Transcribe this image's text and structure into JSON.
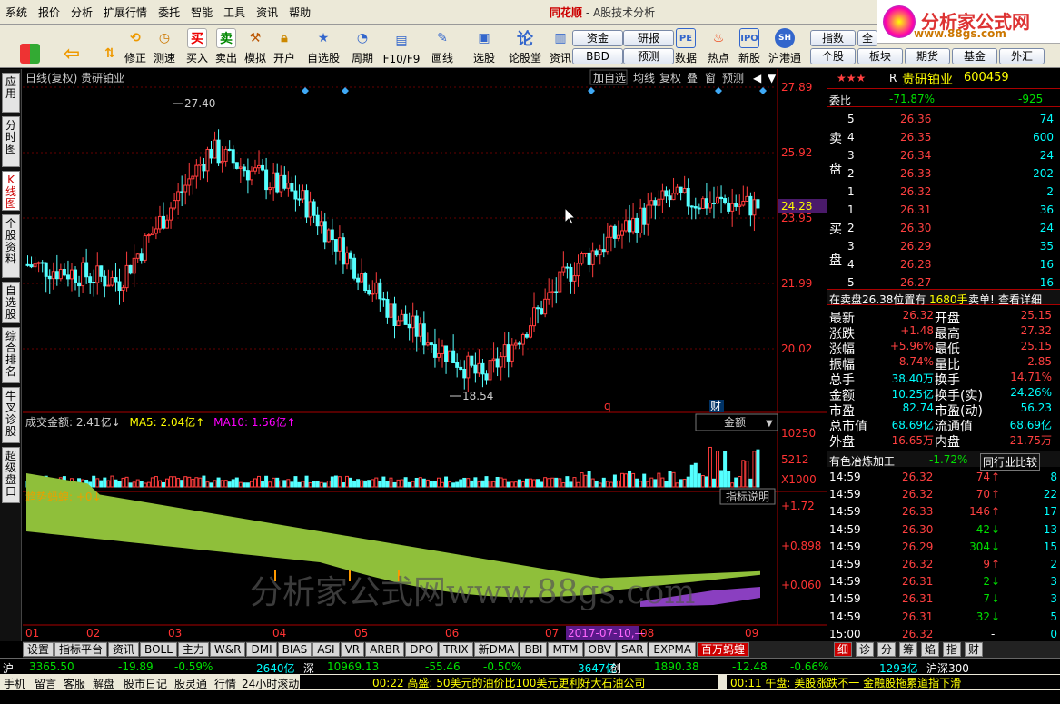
{
  "menu": [
    "系统",
    "报价",
    "分析",
    "扩展行情",
    "委托",
    "智能",
    "工具",
    "资讯",
    "帮助"
  ],
  "app": {
    "brand": "同花顺",
    "sub": " - A股技术分析"
  },
  "toolbar": {
    "buttons": [
      "修正",
      "测速",
      "买入",
      "卖出",
      "模拟",
      "开户",
      "自选股",
      "周期",
      "F10/F9",
      "画线",
      "选股",
      "论股堂",
      "资讯",
      "数据",
      "热点",
      "新股",
      "沪港通"
    ],
    "small": [
      "资金",
      "研报",
      "BBD",
      "预测",
      "指数",
      "全",
      "个股",
      "板块",
      "期货",
      "基金",
      "外汇"
    ]
  },
  "logo": {
    "title": "分析家公式网",
    "url": "www.88gs.com"
  },
  "sidetabs": [
    "应用",
    "分时图",
    "K线图",
    "个股资料",
    "自选股",
    "综合排名",
    "牛叉诊股",
    "超级盘口"
  ],
  "chart": {
    "header": "日线(复权) 贵研铂业",
    "ctrls": [
      "加自选",
      "均线",
      "复权",
      "叠",
      "窗",
      "预测"
    ],
    "high_label": "27.40",
    "low_label": "18.54",
    "y_ticks": [
      "27.89",
      "25.92",
      "23.95",
      "21.99",
      "20.02"
    ],
    "cur_price": "24.28",
    "vol_header": {
      "a": "成交金额: 2.41亿↓",
      "b": "MA5: 2.04亿↑",
      "c": "MA10: 1.56亿↑"
    },
    "vol_select": "金额",
    "vol_ticks": [
      "10250",
      "5212",
      "X1000"
    ],
    "ind_header": "趋势蚂蝗: +0↓",
    "ind_btn": "指标说明",
    "ind_ticks": [
      "+1.72",
      "+0.898",
      "+0.060"
    ],
    "months": [
      "01",
      "02",
      "03",
      "04",
      "05",
      "06",
      "07",
      "08",
      "09"
    ],
    "date_tag": "2017-07-10,—",
    "markers": [
      "q",
      "财"
    ],
    "watermark": "分析家公式网www.88gs.com"
  },
  "chart_data": {
    "type": "line",
    "title": "",
    "x": [
      "01",
      "02",
      "03",
      "04",
      "05",
      "06",
      "07",
      "08",
      "09"
    ],
    "values": [
      22.5,
      22.0,
      26.0,
      24.5,
      21.0,
      19.0,
      22.5,
      24.5,
      24.28
    ],
    "ylim": [
      18.5,
      27.9
    ]
  },
  "rpanel": {
    "stars": "★★★",
    "r": "R",
    "name": "贵研铂业",
    "code": "600459",
    "weibi_label": "委比",
    "weibi": "-71.87%",
    "weicha": "-925",
    "sell": [
      [
        "5",
        "26.36",
        "74"
      ],
      [
        "4",
        "26.35",
        "600"
      ],
      [
        "3",
        "26.34",
        "24"
      ],
      [
        "2",
        "26.33",
        "202"
      ],
      [
        "1",
        "26.32",
        "2"
      ]
    ],
    "buy": [
      [
        "1",
        "26.31",
        "36"
      ],
      [
        "2",
        "26.30",
        "24"
      ],
      [
        "3",
        "26.29",
        "35"
      ],
      [
        "4",
        "26.28",
        "16"
      ],
      [
        "5",
        "26.27",
        "16"
      ]
    ],
    "sell_label": [
      "卖",
      "盘"
    ],
    "buy_label": [
      "买",
      "盘"
    ],
    "info_bar": {
      "a": "在卖盘26.38位置有",
      "b": "1680手",
      "c": "卖单!",
      "d": "查看详细"
    },
    "quote": [
      [
        "最新",
        "26.32",
        "开盘",
        "25.15"
      ],
      [
        "涨跌",
        "+1.48",
        "最高",
        "27.32"
      ],
      [
        "涨幅",
        "+5.96%",
        "最低",
        "25.15"
      ],
      [
        "振幅",
        "8.74%",
        "量比",
        "2.85"
      ],
      [
        "总手",
        "38.40万",
        "换手",
        "14.71%"
      ],
      [
        "金额",
        "10.25亿",
        "换手(实)",
        "24.26%"
      ],
      [
        "市盈",
        "82.74",
        "市盈(动)",
        "56.23"
      ],
      [
        "总市值",
        "68.69亿",
        "流通值",
        "68.69亿"
      ],
      [
        "外盘",
        "16.65万",
        "内盘",
        "21.75万"
      ]
    ],
    "industry": {
      "name": "有色冶炼加工",
      "pct": "-1.72%",
      "btn": "同行业比较"
    },
    "ticks": [
      [
        "14:59",
        "26.32",
        "74",
        "↑",
        "8"
      ],
      [
        "14:59",
        "26.32",
        "70",
        "↑",
        "22"
      ],
      [
        "14:59",
        "26.33",
        "146",
        "↑",
        "17"
      ],
      [
        "14:59",
        "26.30",
        "42",
        "↓",
        "13"
      ],
      [
        "14:59",
        "26.29",
        "304",
        "↓",
        "15"
      ],
      [
        "14:59",
        "26.32",
        "9",
        "↑",
        "2"
      ],
      [
        "14:59",
        "26.31",
        "2",
        "↓",
        "3"
      ],
      [
        "14:59",
        "26.31",
        "7",
        "↓",
        "3"
      ],
      [
        "14:59",
        "26.31",
        "32",
        "↓",
        "5"
      ],
      [
        "15:00",
        "26.32",
        "",
        "-",
        "0"
      ]
    ]
  },
  "bottomtabs": [
    "设置",
    "指标平台",
    "资讯",
    "BOLL",
    "主力",
    "W&R",
    "DMI",
    "BIAS",
    "ASI",
    "VR",
    "ARBR",
    "DPO",
    "TRIX",
    "新DMA",
    "BBI",
    "MTM",
    "OBV",
    "SAR",
    "EXPMA",
    "百万蚂蝗"
  ],
  "rtabs": [
    "细",
    "诊",
    "分",
    "筹",
    "焰",
    "指",
    "财"
  ],
  "status": {
    "sh_label": "沪",
    "sh_idx": "3365.50",
    "sh_chg": "-19.89",
    "sh_pct": "-0.59%",
    "sh_amt": "2640亿",
    "sz_label": "深",
    "sz_idx": "10969.13",
    "sz_chg": "-55.46",
    "sz_pct": "-0.50%",
    "sz_amt": "3647亿",
    "cy_label": "创",
    "cy_idx": "1890.38",
    "cy_chg": "-12.48",
    "cy_pct": "-0.66%",
    "hs_amt": "1293亿",
    "hs_label": "沪深300"
  },
  "status2": {
    "items": [
      "手机",
      "留言",
      "客服",
      "解盘",
      "股市日记",
      "股灵通",
      "行情",
      "24小时滚动"
    ],
    "news1": "00:22 高盛: 50美元的油价比100美元更利好大石油公司",
    "news2": "00:11 午盘: 美股涨跌不一 金融股拖累道指下滑"
  }
}
